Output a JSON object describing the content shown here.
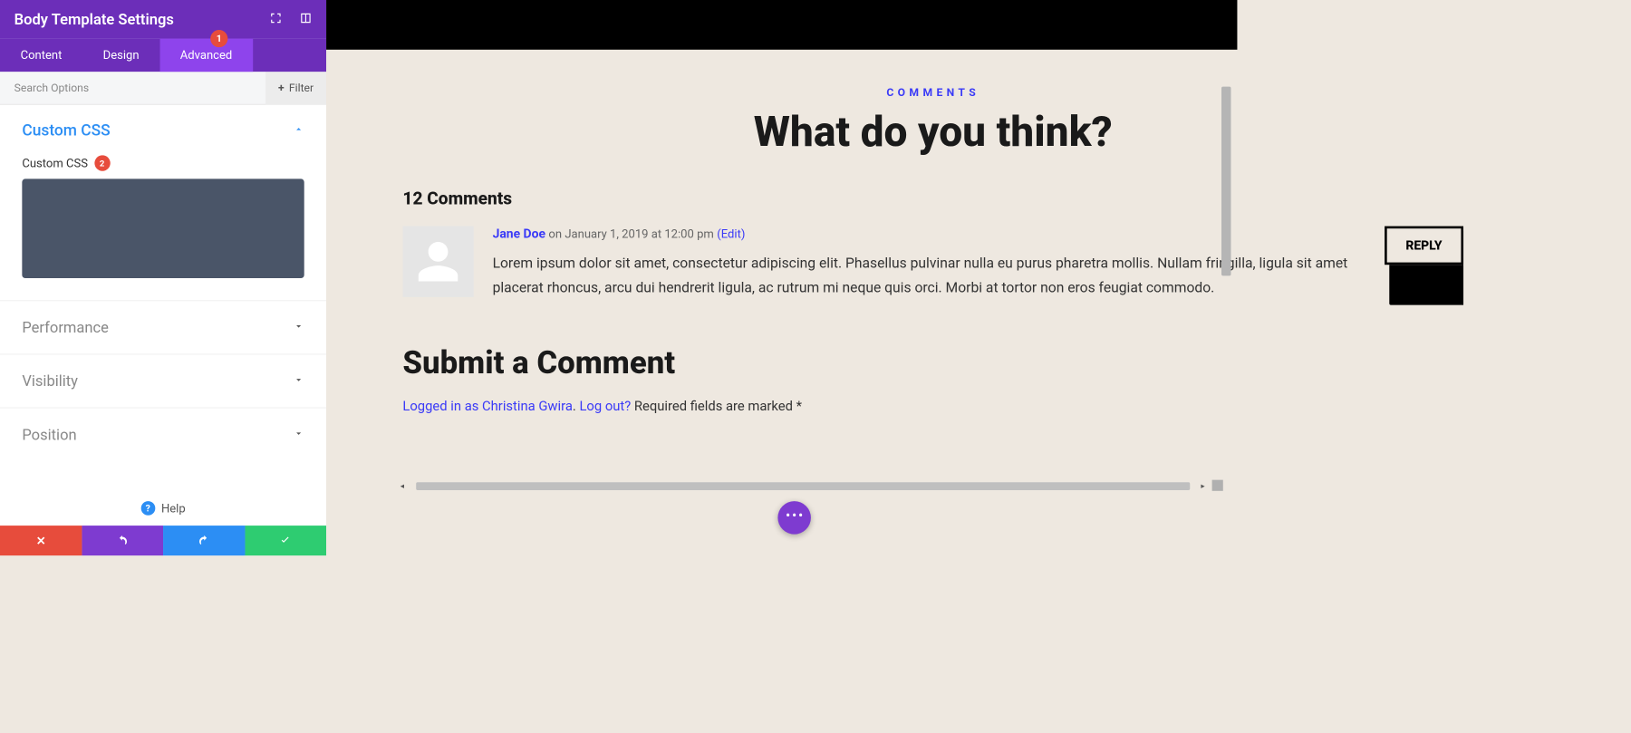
{
  "panel": {
    "title": "Body Template Settings",
    "tabs": {
      "content": "Content",
      "design": "Design",
      "advanced": "Advanced"
    },
    "badge_advanced": "1",
    "search_placeholder": "Search Options",
    "filter_label": "Filter",
    "sections": {
      "custom_css": {
        "title": "Custom CSS",
        "field_label": "Custom CSS",
        "badge": "2"
      },
      "performance": "Performance",
      "visibility": "Visibility",
      "position": "Position"
    },
    "help": "Help"
  },
  "preview": {
    "eyebrow": "COMMENTS",
    "heading": "What do you think?",
    "count": "12 Comments",
    "comment": {
      "author": "Jane Doe",
      "meta_on": "on",
      "date": "January 1, 2019 at 12:00 pm",
      "edit": "(Edit)",
      "text": "Lorem ipsum dolor sit amet, consectetur adipiscing elit. Phasellus pulvinar nulla eu purus pharetra mollis. Nullam fringilla, ligula sit amet placerat rhoncus, arcu dui hendrerit ligula, ac rutrum mi neque quis orci. Morbi at tortor non eros feugiat commodo.",
      "reply": "REPLY"
    },
    "submit": {
      "heading": "Submit a Comment",
      "logged_in_prefix": "Logged in as ",
      "user": "Christina Gwira",
      "logout": "Log out?",
      "required": " Required fields are marked *"
    }
  }
}
